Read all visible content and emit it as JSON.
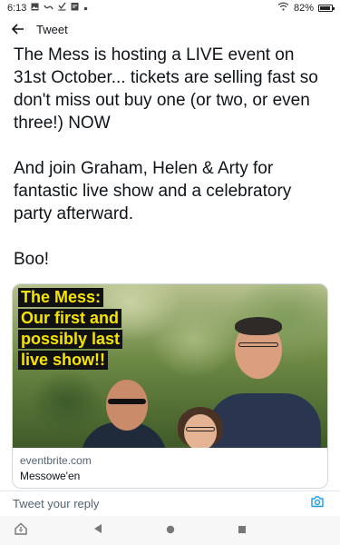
{
  "status_bar": {
    "time": "6:13",
    "battery_percent": "82%",
    "battery_level": 0.82,
    "icons_left": [
      "gallery-icon",
      "squiggle-icon",
      "download-icon",
      "calendar-icon",
      "dot-icon"
    ],
    "icons_right": [
      "wifi-icon",
      "battery-icon"
    ]
  },
  "app_bar": {
    "title": "Tweet",
    "back_icon": "arrow-left-icon"
  },
  "tweet": {
    "paragraphs": [
      "The Mess is hosting a LIVE event on 31st October... tickets are selling fast so don't miss out buy one (or two, or even three!) NOW",
      "And join Graham, Helen & Arty for fantastic live show and a celebratory party afterward.",
      "Boo!"
    ]
  },
  "card": {
    "overlay_lines": [
      "The Mess:",
      "Our first and",
      "possibly last",
      "live show!!"
    ],
    "domain": "eventbrite.com",
    "title": "Messowe'en",
    "overlay_text_color": "#f5e400",
    "overlay_bg_color": "#111111"
  },
  "reply": {
    "placeholder": "Tweet your reply",
    "camera_icon": "camera-icon",
    "accent_color": "#1d9bf0"
  },
  "nav_bar": {
    "icons": [
      "home-accessibility-icon",
      "back-triangle-icon",
      "home-circle-icon",
      "recents-square-icon"
    ]
  }
}
